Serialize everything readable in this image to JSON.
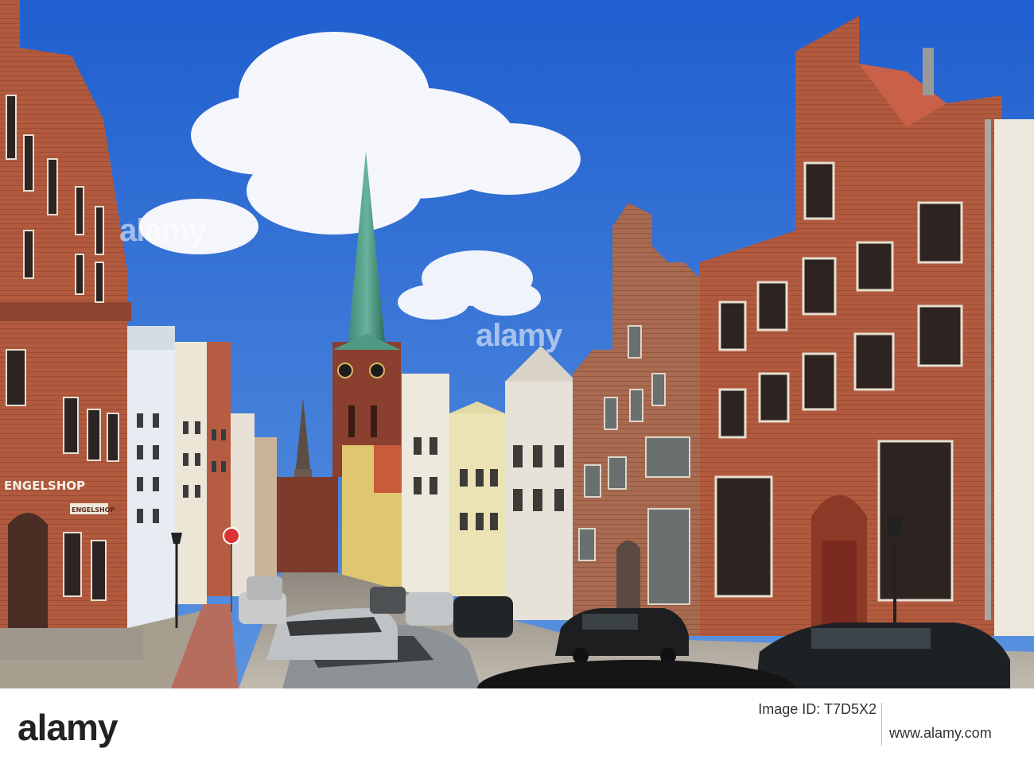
{
  "photo": {
    "shop_sign_main": "ENGELSHOP",
    "shop_sign_small": "ENGELSHOP"
  },
  "watermark": {
    "text_left": "alamy",
    "text_right": "alamy"
  },
  "footer": {
    "logo": "alamy",
    "image_id_label": "Image ID: T7D5X2",
    "image_id": "T7D5X2",
    "site": "www.alamy.com"
  },
  "colors": {
    "sky": "#2f6fd1",
    "brick": "#b7563a",
    "spire": "#4f9a85",
    "pavement": "#b9b2a6"
  }
}
